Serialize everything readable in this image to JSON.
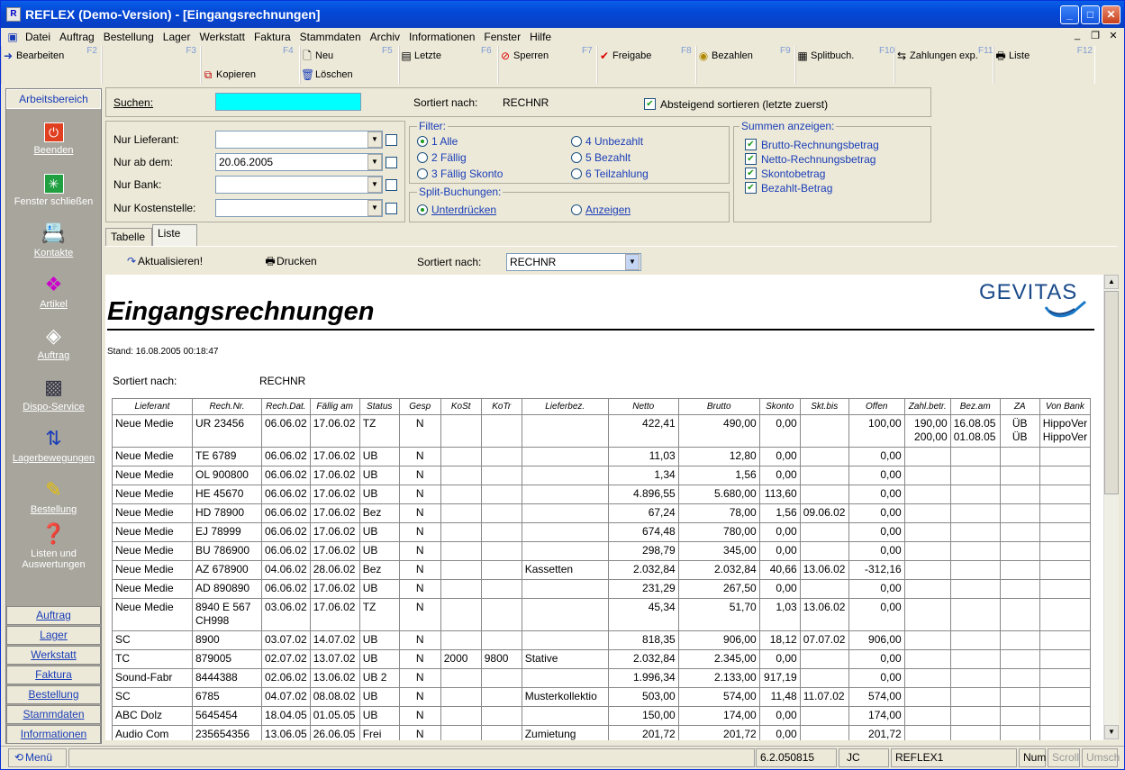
{
  "window": {
    "title": "REFLEX (Demo-Version) - [Eingangsrechnungen]"
  },
  "menu": [
    "Datei",
    "Auftrag",
    "Bestellung",
    "Lager",
    "Werkstatt",
    "Faktura",
    "Stammdaten",
    "Archiv",
    "Informationen",
    "Fenster",
    "Hilfe"
  ],
  "toolbar": {
    "row1": [
      {
        "label": "Bearbeiten",
        "fkey": "F2",
        "icon": "arrow-right-icon"
      },
      {
        "label": "",
        "fkey": "F3",
        "icon": ""
      },
      {
        "label": "Neu",
        "fkey": "F4",
        "icon": "new-document-icon"
      },
      {
        "label": "Letzte",
        "fkey": "F5",
        "icon": "last-icon"
      },
      {
        "label": "Sperren",
        "fkey": "F6",
        "icon": "block-icon"
      },
      {
        "label": "Freigabe",
        "fkey": "F7",
        "icon": "checkmark-icon"
      },
      {
        "label": "Bezahlen",
        "fkey": "F8",
        "icon": "coin-icon"
      },
      {
        "label": "Splitbuch.",
        "fkey": "F9",
        "icon": "split-icon"
      },
      {
        "label": "Zahlungen exp.",
        "fkey": "F10",
        "icon": "export-icon"
      },
      {
        "label": "Liste",
        "fkey": "F11",
        "icon": "printer-icon"
      },
      {
        "label": "",
        "fkey": "F12",
        "icon": ""
      }
    ],
    "row2": [
      {
        "label": "Kopieren",
        "icon": "copy-icon"
      },
      {
        "label": "Löschen",
        "icon": "trash-icon"
      }
    ]
  },
  "sidebar": {
    "header": "Arbeitsbereich",
    "items": [
      "Beenden",
      "Fenster schließen",
      "Kontakte",
      "Artikel",
      "Auftrag",
      "Dispo-Service",
      "Lagerbewegungen",
      "Bestellung",
      "Listen und Auswertungen"
    ],
    "nav": [
      "Auftrag",
      "Lager",
      "Werkstatt",
      "Faktura",
      "Bestellung",
      "Stammdaten",
      "Informationen"
    ]
  },
  "search": {
    "label": "Suchen:",
    "value": "",
    "sorted_label": "Sortiert nach:",
    "sorted_value": "RECHNR",
    "desc_label": "Absteigend sortieren (letzte zuerst)",
    "desc_checked": true
  },
  "filters": {
    "lieferant_label": "Nur Lieferant:",
    "ab_dem_label": "Nur ab dem:",
    "ab_dem_value": "20.06.2005",
    "bank_label": "Nur Bank:",
    "kostenstelle_label": "Nur Kostenstelle:"
  },
  "filter_group": {
    "title": "Filter:",
    "options": [
      "1 Alle",
      "2 Fällig",
      "3 Fällig Skonto",
      "4 Unbezahlt",
      "5 Bezahlt",
      "6 Teilzahlung"
    ],
    "selected": 0
  },
  "split_group": {
    "title": "Split-Buchungen:",
    "options": [
      "Unterdrücken",
      "Anzeigen"
    ],
    "selected": 0
  },
  "summen_group": {
    "title": "Summen anzeigen:",
    "options": [
      "Brutto-Rechnungsbetrag",
      "Netto-Rechnungsbetrag",
      "Skontobetrag",
      "Bezahlt-Betrag"
    ]
  },
  "tabs": [
    "Tabelle",
    "Liste"
  ],
  "active_tab": 1,
  "listbar": {
    "refresh": "Aktualisieren!",
    "print": "Drucken",
    "sorted_label": "Sortiert nach:",
    "sorted_value": "RECHNR"
  },
  "report": {
    "title": "Eingangsrechnungen",
    "logo": "GEVITAS",
    "stand": "Stand: 16.08.2005 00:18:47",
    "sorted_label": "Sortiert nach:",
    "sorted_value": "RECHNR",
    "columns": [
      "Lieferant",
      "Rech.Nr.",
      "Rech.Dat.",
      "Fällig am",
      "Status",
      "Gesp",
      "KoSt",
      "KoTr",
      "Lieferbez.",
      "Netto",
      "Brutto",
      "Skonto",
      "Skt.bis",
      "Offen",
      "Zahl.betr.",
      "Bez.am",
      "ZA",
      "Von Bank"
    ],
    "rows": [
      [
        "Neue Medie",
        "UR 23456",
        "06.06.02",
        "17.06.02",
        "TZ",
        "N",
        "",
        "",
        "",
        "422,41",
        "490,00",
        "0,00",
        "",
        "100,00",
        "190,00\n200,00",
        "16.08.05\n01.08.05",
        "ÜB\nÜB",
        "HippoVer\nHippoVer"
      ],
      [
        "Neue Medie",
        "TE 6789",
        "06.06.02",
        "17.06.02",
        "UB",
        "N",
        "",
        "",
        "",
        "11,03",
        "12,80",
        "0,00",
        "",
        "0,00",
        "",
        "",
        "",
        ""
      ],
      [
        "Neue Medie",
        "OL 900800",
        "06.06.02",
        "17.06.02",
        "UB",
        "N",
        "",
        "",
        "",
        "1,34",
        "1,56",
        "0,00",
        "",
        "0,00",
        "",
        "",
        "",
        ""
      ],
      [
        "Neue Medie",
        "HE 45670",
        "06.06.02",
        "17.06.02",
        "UB",
        "N",
        "",
        "",
        "",
        "4.896,55",
        "5.680,00",
        "113,60",
        "",
        "0,00",
        "",
        "",
        "",
        ""
      ],
      [
        "Neue Medie",
        "HD 78900",
        "06.06.02",
        "17.06.02",
        "Bez",
        "N",
        "",
        "",
        "",
        "67,24",
        "78,00",
        "1,56",
        "09.06.02",
        "0,00",
        "",
        "",
        "",
        ""
      ],
      [
        "Neue Medie",
        "EJ 78999",
        "06.06.02",
        "17.06.02",
        "UB",
        "N",
        "",
        "",
        "",
        "674,48",
        "780,00",
        "0,00",
        "",
        "0,00",
        "",
        "",
        "",
        ""
      ],
      [
        "Neue Medie",
        "BU 786900",
        "06.06.02",
        "17.06.02",
        "UB",
        "N",
        "",
        "",
        "",
        "298,79",
        "345,00",
        "0,00",
        "",
        "0,00",
        "",
        "",
        "",
        ""
      ],
      [
        "Neue Medie",
        "AZ 678900",
        "04.06.02",
        "28.06.02",
        "Bez",
        "N",
        "",
        "",
        "Kassetten",
        "2.032,84",
        "2.032,84",
        "40,66",
        "13.06.02",
        "-312,16",
        "",
        "",
        "",
        ""
      ],
      [
        "Neue Medie",
        "AD 890890",
        "06.06.02",
        "17.06.02",
        "UB",
        "N",
        "",
        "",
        "",
        "231,29",
        "267,50",
        "0,00",
        "",
        "0,00",
        "",
        "",
        "",
        ""
      ],
      [
        "Neue Medie",
        "8940 E 567\nCH998",
        "03.06.02",
        "17.06.02",
        "TZ",
        "N",
        "",
        "",
        "",
        "45,34",
        "51,70",
        "1,03",
        "13.06.02",
        "0,00",
        "",
        "",
        "",
        ""
      ],
      [
        "SC",
        "8900",
        "03.07.02",
        "14.07.02",
        "UB",
        "N",
        "",
        "",
        "",
        "818,35",
        "906,00",
        "18,12",
        "07.07.02",
        "906,00",
        "",
        "",
        "",
        ""
      ],
      [
        "TC",
        "879005",
        "02.07.02",
        "13.07.02",
        "UB",
        "N",
        "2000",
        "9800",
        "Stative",
        "2.032,84",
        "2.345,00",
        "0,00",
        "",
        "0,00",
        "",
        "",
        "",
        ""
      ],
      [
        "Sound-Fabr",
        "8444388",
        "02.06.02",
        "13.06.02",
        "UB 2",
        "N",
        "",
        "",
        "",
        "1.996,34",
        "2.133,00",
        "917,19",
        "",
        "0,00",
        "",
        "",
        "",
        ""
      ],
      [
        "SC",
        "6785",
        "04.07.02",
        "08.08.02",
        "UB",
        "N",
        "",
        "",
        "Musterkollektio",
        "503,00",
        "574,00",
        "11,48",
        "11.07.02",
        "574,00",
        "",
        "",
        "",
        ""
      ],
      [
        "ABC Dolz",
        "5645454",
        "18.04.05",
        "01.05.05",
        "UB",
        "N",
        "",
        "",
        "",
        "150,00",
        "174,00",
        "0,00",
        "",
        "174,00",
        "",
        "",
        "",
        ""
      ],
      [
        "Audio Com",
        "235654356",
        "13.06.05",
        "26.06.05",
        "Frei",
        "N",
        "",
        "",
        "Zumietung",
        "201,72",
        "201,72",
        "0,00",
        "",
        "201,72",
        "",
        "",
        "",
        ""
      ]
    ]
  },
  "status": {
    "menu": "Menü",
    "version": "6.2.050815",
    "user": "JC",
    "db": "REFLEX1",
    "num": "Num",
    "scroll": "Scroll",
    "umsch": "Umsch"
  }
}
